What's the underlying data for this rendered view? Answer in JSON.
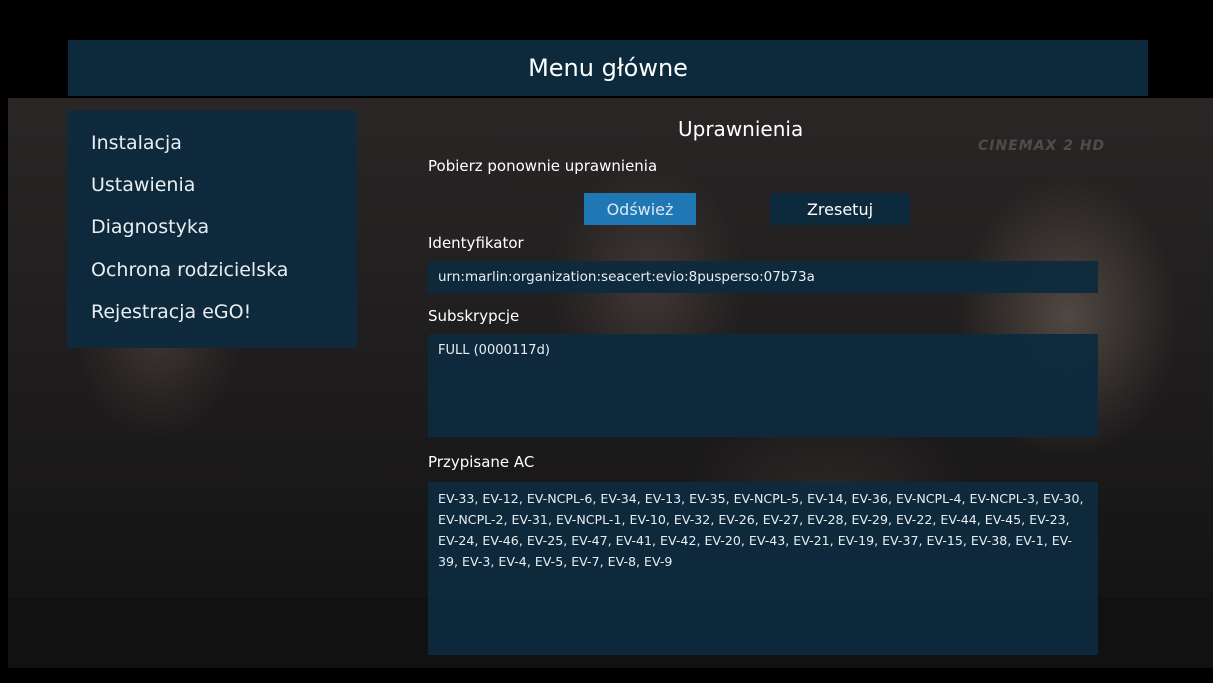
{
  "header": {
    "title": "Menu główne"
  },
  "background": {
    "channel_logo": "CINEMAX 2 HD"
  },
  "sidebar": {
    "items": [
      {
        "label": "Instalacja"
      },
      {
        "label": "Ustawienia"
      },
      {
        "label": "Diagnostyka"
      },
      {
        "label": "Ochrona rodzicielska"
      },
      {
        "label": "Rejestracja eGO!"
      }
    ]
  },
  "main": {
    "title": "Uprawnienia",
    "refetch_label": "Pobierz ponownie uprawnienia",
    "buttons": {
      "refresh": "Odśwież",
      "reset": "Zresetuj"
    },
    "identifier": {
      "label": "Identyfikator",
      "value": "urn:marlin:organization:seacert:evio:8pusperso:07b73a"
    },
    "subscriptions": {
      "label": "Subskrypcje",
      "value": "FULL (0000117d)"
    },
    "assigned_ac": {
      "label": "Przypisane AC",
      "value": "EV-33, EV-12, EV-NCPL-6, EV-34, EV-13, EV-35, EV-NCPL-5, EV-14, EV-36, EV-NCPL-4, EV-NCPL-3, EV-30, EV-NCPL-2, EV-31, EV-NCPL-1, EV-10, EV-32, EV-26, EV-27, EV-28, EV-29, EV-22, EV-44, EV-45, EV-23, EV-24, EV-46, EV-25, EV-47, EV-41, EV-42, EV-20, EV-43, EV-21, EV-19, EV-37, EV-15, EV-38, EV-1, EV-39, EV-3, EV-4, EV-5, EV-7, EV-8, EV-9"
    }
  },
  "colors": {
    "panel": "#0d2a3d",
    "accent_focus": "#1f77b4",
    "text": "#ffffff"
  }
}
